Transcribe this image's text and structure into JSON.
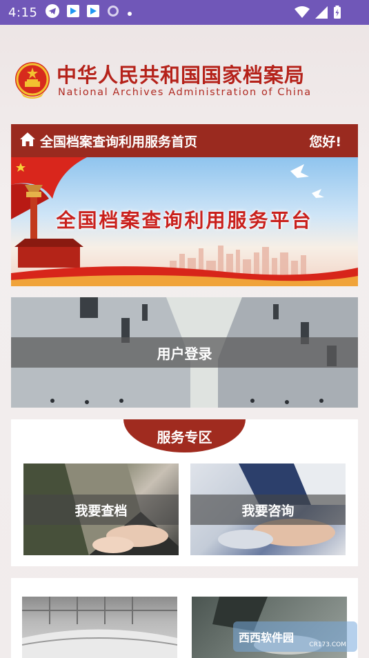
{
  "status_bar": {
    "time": "4:15",
    "icons": [
      "telegram-icon",
      "play-store-icon",
      "play-store-icon",
      "sync-circle-icon",
      "dot-icon",
      "wifi-icon",
      "signal-icon",
      "battery-charging-icon"
    ]
  },
  "header": {
    "org_name_cn": "中华人民共和国国家档案局",
    "org_name_en": "National Archives Administration of China"
  },
  "title_bar": {
    "title": "全国档案查询利用服务首页",
    "greeting": "您好!"
  },
  "banner": {
    "title": "全国档案查询利用服务平台"
  },
  "login": {
    "label": "用户登录"
  },
  "service": {
    "tab_label": "服务专区",
    "cards": [
      {
        "label": "我要查档"
      },
      {
        "label": "我要咨询"
      }
    ]
  },
  "watermark": {
    "text": "西西软件园",
    "sub": "CR173.COM"
  },
  "colors": {
    "status_bar": "#7057b8",
    "brand_red": "#9a2a1f",
    "title_red": "#b5221a"
  }
}
